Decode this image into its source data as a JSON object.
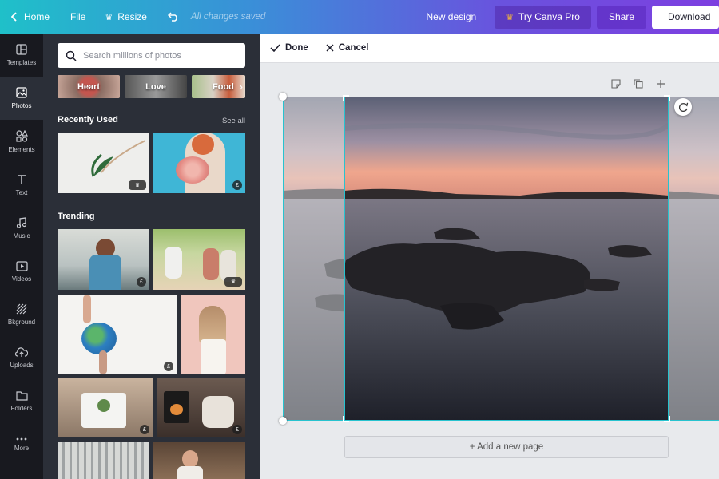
{
  "topbar": {
    "home_label": "Home",
    "file_label": "File",
    "resize_label": "Resize",
    "saved_status": "All changes saved",
    "new_design_label": "New design",
    "try_pro_label": "Try Canva Pro",
    "share_label": "Share",
    "download_label": "Download"
  },
  "rail": {
    "items": [
      {
        "label": "Templates",
        "icon": "templates-icon"
      },
      {
        "label": "Photos",
        "icon": "photos-icon"
      },
      {
        "label": "Elements",
        "icon": "elements-icon"
      },
      {
        "label": "Text",
        "icon": "text-icon"
      },
      {
        "label": "Music",
        "icon": "music-icon"
      },
      {
        "label": "Videos",
        "icon": "videos-icon"
      },
      {
        "label": "Bkground",
        "icon": "background-icon"
      },
      {
        "label": "Uploads",
        "icon": "uploads-icon"
      },
      {
        "label": "Folders",
        "icon": "folders-icon"
      },
      {
        "label": "More",
        "icon": "more-icon"
      }
    ],
    "active": "Photos"
  },
  "panel": {
    "search_placeholder": "Search millions of photos",
    "chips": [
      "Heart",
      "Love",
      "Food"
    ],
    "recently_used_title": "Recently Used",
    "see_all_label": "See all",
    "trending_title": "Trending",
    "price_badge": "£"
  },
  "crop_toolbar": {
    "done_label": "Done",
    "cancel_label": "Cancel"
  },
  "canvas": {
    "add_page_label": "+ Add a new page"
  },
  "colors": {
    "accent": "#27c3cf",
    "rail_bg": "#18191f",
    "panel_bg": "#2b2f38",
    "gradient_start": "#1fc0c9",
    "gradient_end": "#7d3fe0"
  }
}
